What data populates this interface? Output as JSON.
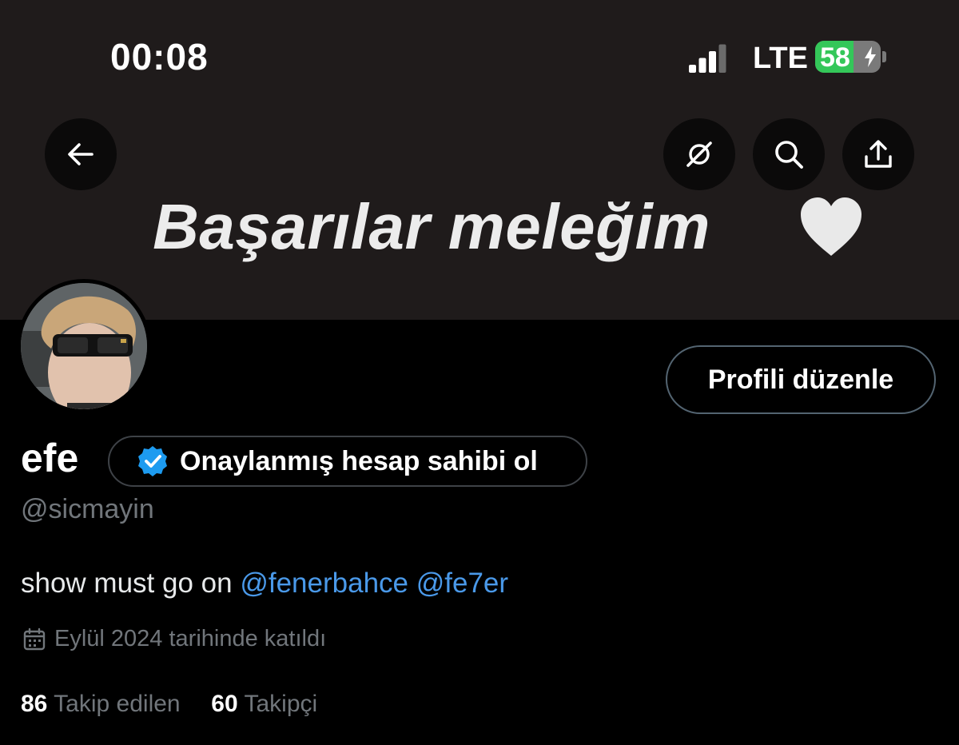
{
  "status_bar": {
    "time": "00:08",
    "network": "LTE",
    "battery_level": "58",
    "battery_fraction": 0.58,
    "signal_bars_active": 3,
    "signal_bars_total": 4
  },
  "header": {
    "back_icon": "arrow-left-icon",
    "actions": [
      "grok-icon",
      "search-icon",
      "share-icon"
    ]
  },
  "banner": {
    "text": "Başarılar meleğim",
    "emoji": "white-heart-icon",
    "background_color": "#1f1b1b"
  },
  "profile": {
    "edit_button": "Profili düzenle",
    "name": "efe",
    "verify_prompt": "Onaylanmış hesap sahibi ol",
    "handle": "@sicmayin",
    "bio_text": "show must go on",
    "bio_mentions": [
      "@fenerbahce",
      "@fe7er"
    ],
    "joined": "Eylül 2024 tarihinde katıldı",
    "following_count": "86",
    "following_label": "Takip edilen",
    "followers_count": "60",
    "followers_label": "Takipçi"
  },
  "colors": {
    "background": "#000000",
    "accent": "#1d9bf0",
    "mention": "#4a99e9",
    "secondary_text": "#71767b",
    "battery_green": "#34c759"
  }
}
